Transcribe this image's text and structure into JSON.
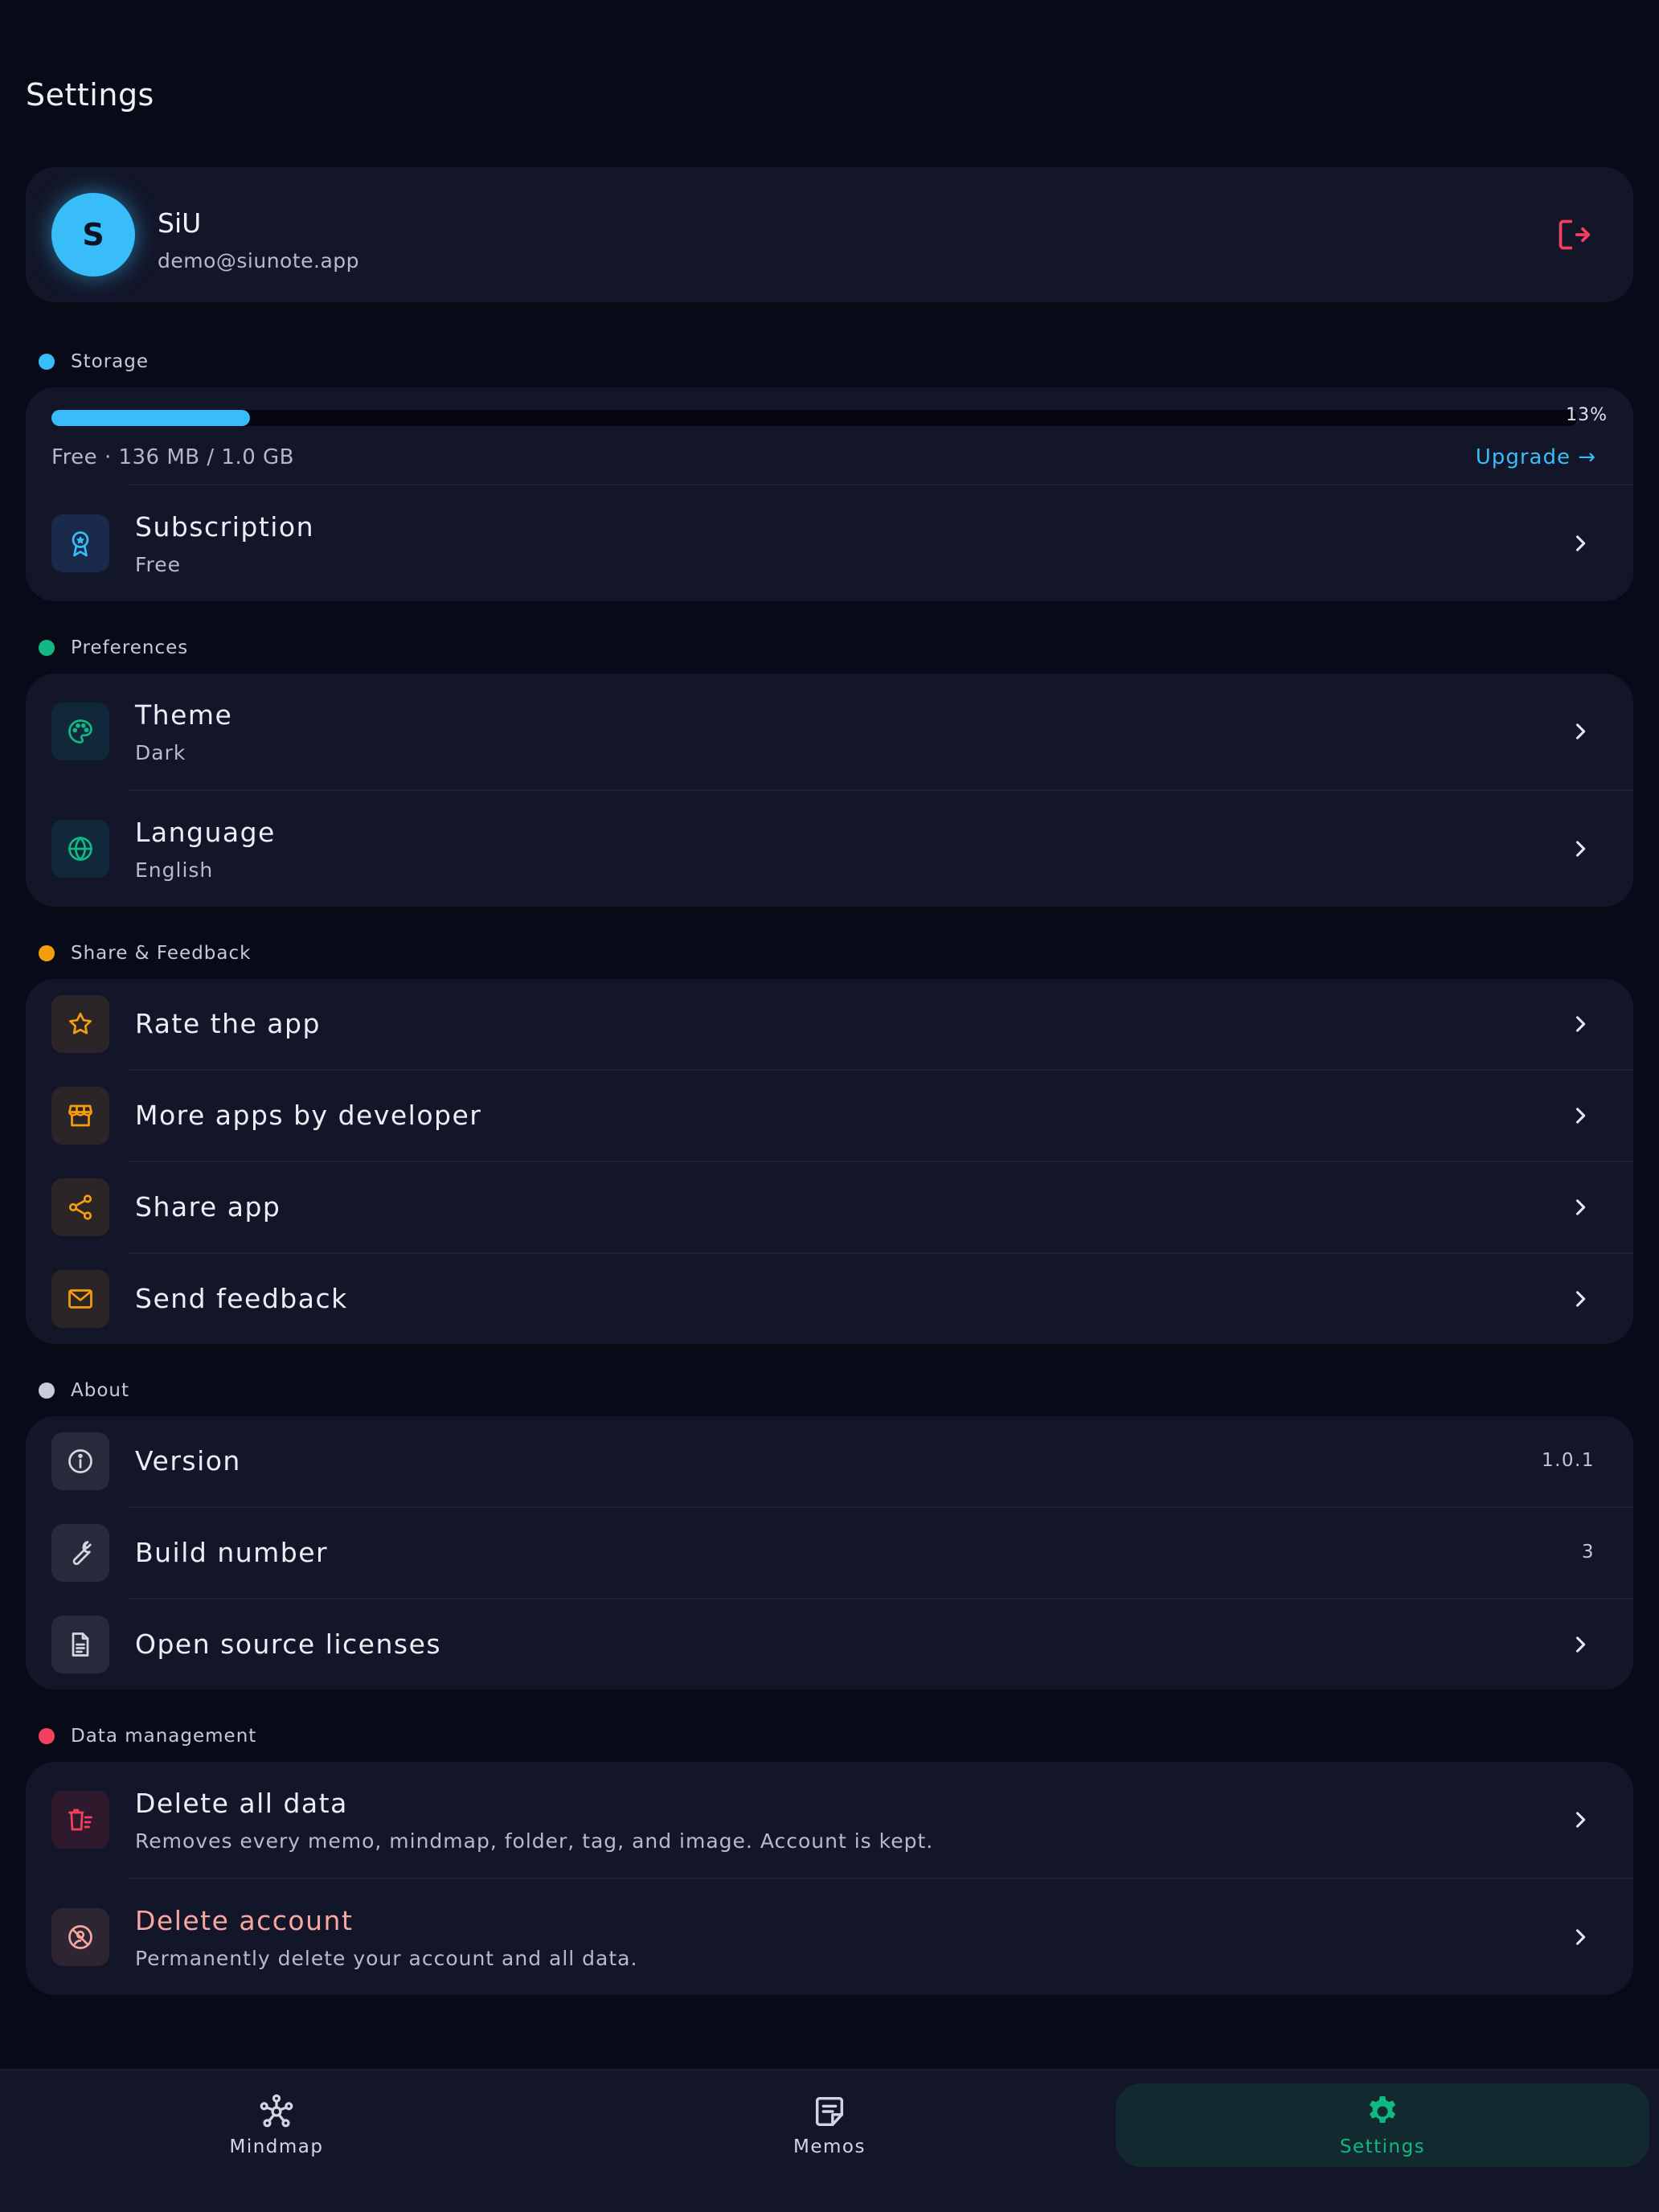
{
  "page": {
    "title": "Settings"
  },
  "profile": {
    "initial": "S",
    "name": "SiU",
    "email": "demo@siunote.app"
  },
  "sections": {
    "storage": "Storage",
    "preferences": "Preferences",
    "share": "Share & Feedback",
    "about": "About",
    "data": "Data management"
  },
  "colors": {
    "storage": "#38bdf8",
    "preferences": "#10b981",
    "share": "#f59e0b",
    "about": "#c9ccd8",
    "data": "#f43f5e"
  },
  "storage": {
    "percent_label": "13%",
    "used_fraction": 0.13,
    "usage_text": "Free · 136 MB / 1.0 GB",
    "upgrade_label": "Upgrade →"
  },
  "subscription": {
    "title": "Subscription",
    "value": "Free",
    "icon": "award-icon"
  },
  "preferences": {
    "theme": {
      "title": "Theme",
      "value": "Dark",
      "icon": "palette-icon"
    },
    "language": {
      "title": "Language",
      "value": "English",
      "icon": "globe-icon"
    }
  },
  "share": {
    "rate": {
      "title": "Rate the app",
      "icon": "star-icon"
    },
    "more_apps": {
      "title": "More apps by developer",
      "icon": "store-icon"
    },
    "share_app": {
      "title": "Share app",
      "icon": "share-icon"
    },
    "feedback": {
      "title": "Send feedback",
      "icon": "mail-icon"
    }
  },
  "about": {
    "version": {
      "title": "Version",
      "value": "1.0.1",
      "icon": "info-icon"
    },
    "build": {
      "title": "Build number",
      "value": "3",
      "icon": "wrench-icon"
    },
    "licenses": {
      "title": "Open source licenses",
      "icon": "document-icon"
    }
  },
  "data_management": {
    "delete_data": {
      "title": "Delete all data",
      "subtitle": "Removes every memo, mindmap, folder, tag, and image. Account is kept.",
      "icon": "trash-icon"
    },
    "delete_account": {
      "title": "Delete account",
      "subtitle": "Permanently delete your account and all data.",
      "icon": "ban-user-icon"
    }
  },
  "nav": {
    "mindmap": "Mindmap",
    "memos": "Memos",
    "settings": "Settings",
    "active": "settings"
  }
}
